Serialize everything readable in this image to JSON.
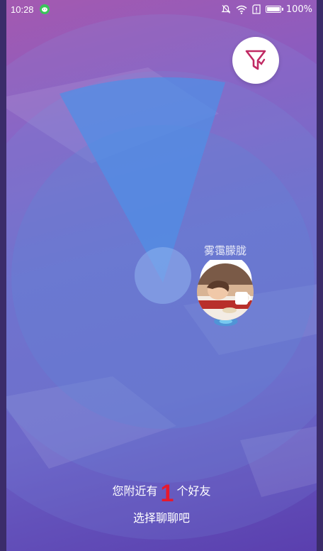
{
  "status_bar": {
    "time": "10:28",
    "battery": "100%",
    "battery_level": 1.0,
    "icons": [
      "wechat-icon",
      "mute-icon",
      "wifi-icon",
      "alert-icon",
      "battery-icon"
    ]
  },
  "filter": {
    "icon": "filter-icon"
  },
  "radar": {
    "friend": {
      "name": "雾霭朦胧",
      "avatar": "avatar-photo"
    }
  },
  "footer": {
    "prefix": "您附近有",
    "count": "1",
    "suffix": "个好友",
    "action": "选择聊聊吧"
  },
  "colors": {
    "accent_red": "#e8192c",
    "filter_icon": "#c02a63",
    "radar_fill": "#5a86d6",
    "pin_shadow": "#3aa2d8"
  }
}
